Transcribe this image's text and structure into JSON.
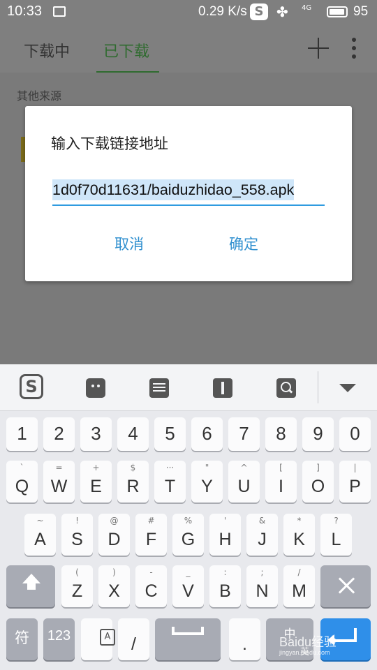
{
  "status_bar": {
    "time": "10:33",
    "network_speed": "0.29 K/s",
    "signal": "4G",
    "battery": "95",
    "battery_level": 0.95
  },
  "app_bar": {
    "tabs": [
      {
        "label": "下载中",
        "active": false
      },
      {
        "label": "已下载",
        "active": true
      }
    ]
  },
  "content": {
    "section_title": "其他来源"
  },
  "dialog": {
    "title": "输入下载链接地址",
    "input_value": "1d0f70d11631/baiduzhidao_558.apk",
    "cancel_label": "取消",
    "confirm_label": "确定"
  },
  "keyboard": {
    "toolbar_icons": [
      "sogou-logo",
      "emoji-icon",
      "keyboard-icon",
      "cursor-icon",
      "search-icon",
      "collapse-icon"
    ],
    "number_row": [
      "1",
      "2",
      "3",
      "4",
      "5",
      "6",
      "7",
      "8",
      "9",
      "0"
    ],
    "row1": [
      {
        "main": "Q",
        "sub": "`"
      },
      {
        "main": "W",
        "sub": "="
      },
      {
        "main": "E",
        "sub": "+"
      },
      {
        "main": "R",
        "sub": "$"
      },
      {
        "main": "T",
        "sub": "···"
      },
      {
        "main": "Y",
        "sub": "\""
      },
      {
        "main": "U",
        "sub": "^"
      },
      {
        "main": "I",
        "sub": "["
      },
      {
        "main": "O",
        "sub": "]"
      },
      {
        "main": "P",
        "sub": "|"
      }
    ],
    "row2": [
      {
        "main": "A",
        "sub": "~"
      },
      {
        "main": "S",
        "sub": "!"
      },
      {
        "main": "D",
        "sub": "@"
      },
      {
        "main": "F",
        "sub": "#"
      },
      {
        "main": "G",
        "sub": "%"
      },
      {
        "main": "H",
        "sub": "'"
      },
      {
        "main": "J",
        "sub": "&"
      },
      {
        "main": "K",
        "sub": "*"
      },
      {
        "main": "L",
        "sub": "?"
      }
    ],
    "row3": [
      {
        "main": "Z",
        "sub": "("
      },
      {
        "main": "X",
        "sub": ")"
      },
      {
        "main": "C",
        "sub": "-"
      },
      {
        "main": "V",
        "sub": "_"
      },
      {
        "main": "B",
        "sub": ":"
      },
      {
        "main": "N",
        "sub": ";"
      },
      {
        "main": "M",
        "sub": "/"
      }
    ],
    "bottom": {
      "symbol_label": "符",
      "numbers_label": "123",
      "tofu_label": "A",
      "slash_label": "/",
      "period_label": ".",
      "lang_label": "中",
      "lang_sub": "英"
    }
  },
  "watermark": {
    "text": "Baidu经验",
    "sub": "jingyan.baidu.com"
  }
}
